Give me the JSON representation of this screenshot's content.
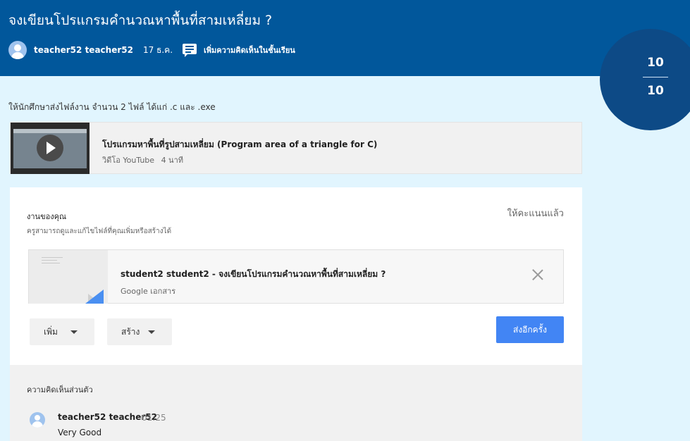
{
  "header": {
    "title": "จงเขียนโปรแกรมคำนวณหาพื้นที่สามเหลี่ยม ?",
    "author": "teacher52 teacher52",
    "date": "17 ธ.ค.",
    "add_comment_label": "เพิ่มความคิดเห็นในชั้นเรียน",
    "background_color": "#01579b"
  },
  "score": {
    "earned": "10",
    "total": "10",
    "background_color": "#0d4a86"
  },
  "instructions": "ให้นักศึกษาส่งไฟล์งาน จำนวน 2 ไฟล์ ได้แก่ .c และ .exe",
  "video": {
    "title": "โปรแกรมหาพื้นที่รูปสามเหลี่ยม (Program area of a triangle for C)",
    "source": "วิดีโอ YouTube",
    "duration": "4 นาที",
    "icon": "play-icon"
  },
  "your_work": {
    "title": "งานของคุณ",
    "subtitle": "ครูสามารถดูและแก้ไขไฟล์ที่คุณเพิ่มหรือสร้างได้",
    "status": "ให้คะแนนแล้ว",
    "attachment": {
      "title": "student2 student2 - จงเขียนโปรแกรมคำนวณหาพื้นที่สามเหลี่ยม ?",
      "type": "Google เอกสาร",
      "icon": "close-icon"
    },
    "add_label": "เพิ่ม",
    "create_label": "สร้าง",
    "resubmit_label": "ส่งอีกครั้ง",
    "resubmit_color": "#4285f4"
  },
  "private_comments": {
    "title": "ความคิดเห็นส่วนตัว",
    "items": [
      {
        "author": "teacher52 teacher52",
        "time": "01:25",
        "text": "Very Good"
      }
    ]
  }
}
